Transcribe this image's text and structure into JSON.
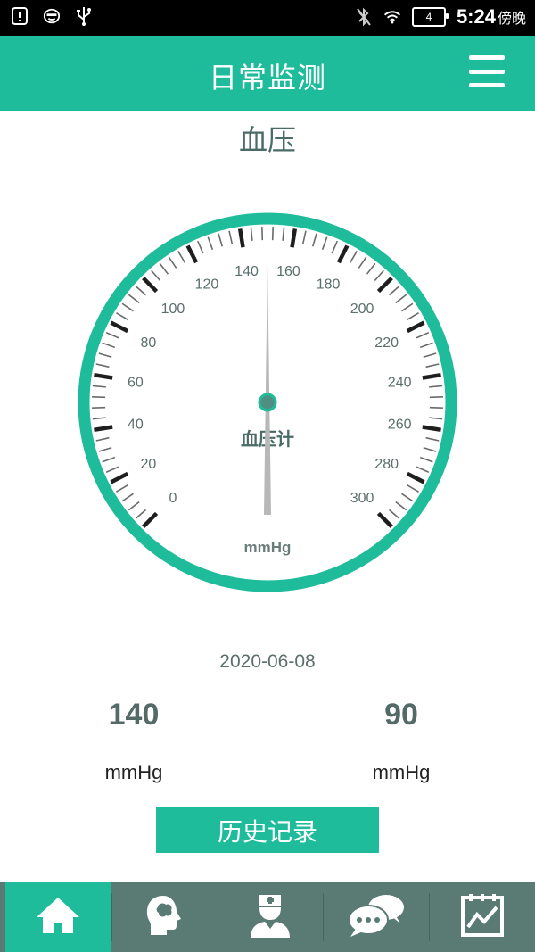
{
  "status_bar": {
    "time": "5:24",
    "time_suffix": "傍晚",
    "battery_level": "4",
    "icons": [
      "alert-icon",
      "face-icon",
      "usb-icon",
      "bluetooth-off-icon",
      "wifi-icon",
      "battery-icon"
    ]
  },
  "header": {
    "title": "日常监测",
    "menu_icon": "hamburger-menu-icon"
  },
  "section": {
    "title": "血压"
  },
  "gauge": {
    "label": "血压计",
    "unit": "mmHg",
    "min": 0,
    "max": 300,
    "needle_value": 150,
    "tick_labels": [
      "0",
      "20",
      "40",
      "60",
      "80",
      "100",
      "120",
      "140",
      "160",
      "180",
      "200",
      "220",
      "240",
      "260",
      "280",
      "300"
    ],
    "ring_color": "#1fbc9b",
    "needle_color": "#b8b8b8"
  },
  "reading": {
    "date": "2020-06-08",
    "systolic": "140",
    "diastolic": "90",
    "systolic_unit": "mmHg",
    "diastolic_unit": "mmHg"
  },
  "actions": {
    "history_label": "历史记录"
  },
  "bottom_nav": {
    "items": [
      {
        "icon": "home-icon",
        "active": true
      },
      {
        "icon": "head-profile-icon",
        "active": false
      },
      {
        "icon": "doctor-icon",
        "active": false
      },
      {
        "icon": "chat-bubbles-icon",
        "active": false
      },
      {
        "icon": "chart-report-icon",
        "active": false
      }
    ]
  },
  "colors": {
    "accent": "#1fbc9b",
    "nav_bg": "#5a7a74",
    "text_dark": "#4a6b66"
  }
}
